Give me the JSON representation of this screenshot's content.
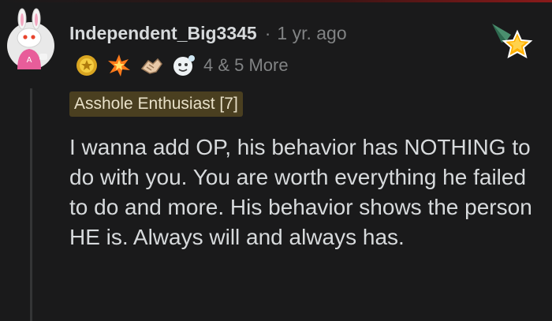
{
  "comment": {
    "username": "Independent_Big3345",
    "separator": "·",
    "timestamp": "1 yr. ago",
    "awards": [
      {
        "icon": "gold-medal-icon"
      },
      {
        "icon": "starstruck-icon"
      },
      {
        "icon": "handshake-icon"
      },
      {
        "icon": "bubble-face-icon"
      }
    ],
    "awards_more": "4 & 5 More",
    "flair": "Asshole Enthusiast [7]",
    "body": "I wanna add OP, his behavior has NOTHING to do with you. You are worth everything he failed to do and more. His behavior shows the person HE is. Always will and always has."
  },
  "colors": {
    "background": "#1a1a1b",
    "text": "#d7dadc",
    "muted": "#818384",
    "flair_bg": "#4a3f20"
  }
}
